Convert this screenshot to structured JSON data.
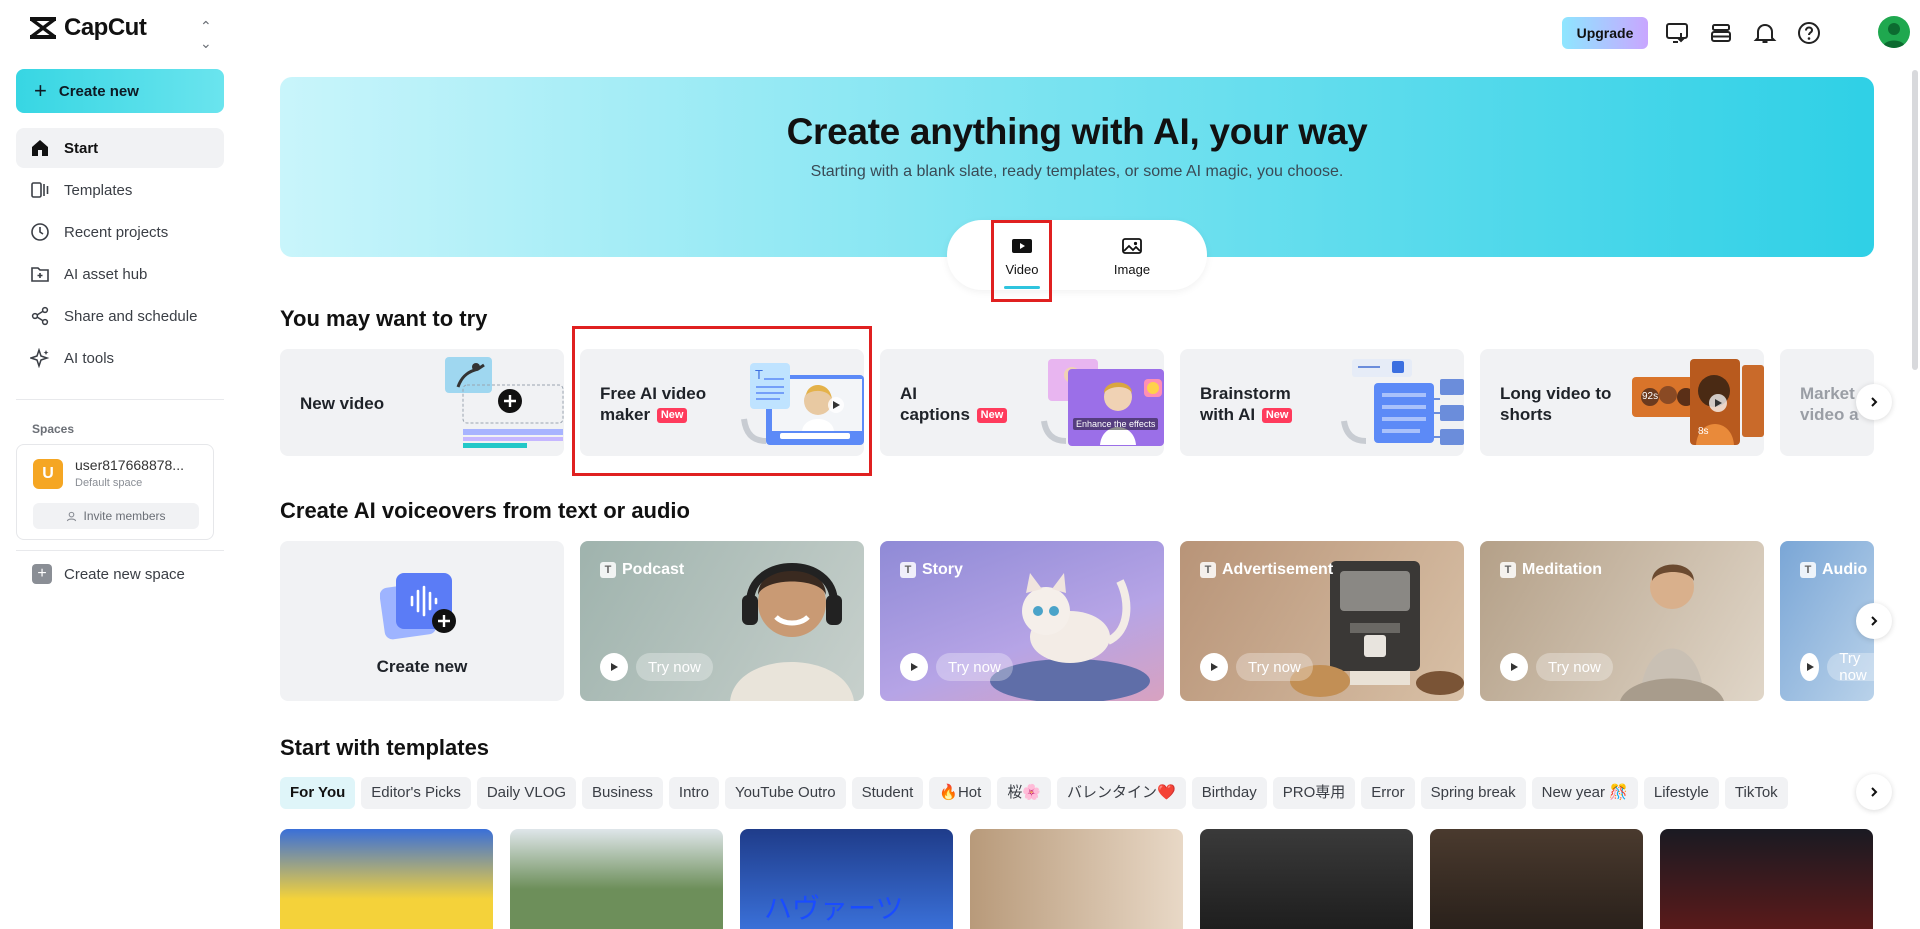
{
  "app": {
    "name": "CapCut"
  },
  "sidebar": {
    "create_new": "Create new",
    "items": [
      {
        "label": "Start"
      },
      {
        "label": "Templates"
      },
      {
        "label": "Recent projects"
      },
      {
        "label": "AI asset hub"
      },
      {
        "label": "Share and schedule"
      },
      {
        "label": "AI tools"
      }
    ],
    "spaces_label": "Spaces",
    "space": {
      "initial": "U",
      "name": "user817668878...",
      "sub": "Default space",
      "invite": "Invite members"
    },
    "create_space": "Create new space"
  },
  "topbar": {
    "upgrade": "Upgrade"
  },
  "hero": {
    "title": "Create anything with AI, your way",
    "subtitle": "Starting with a blank slate, ready templates, or some AI magic, you choose.",
    "modes": [
      {
        "label": "Video"
      },
      {
        "label": "Image"
      }
    ]
  },
  "try_section": {
    "title": "You may want to try",
    "cards": [
      {
        "line1": "New video",
        "line2": "",
        "badge": ""
      },
      {
        "line1": "Free AI video",
        "line2": "maker",
        "badge": "New"
      },
      {
        "line1": "AI",
        "line2": "captions",
        "badge": "New"
      },
      {
        "line1": "Brainstorm",
        "line2": "with AI",
        "badge": "New"
      },
      {
        "line1": "Long video to",
        "line2": "shorts",
        "badge": ""
      },
      {
        "line1": "Market",
        "line2": "video a",
        "badge": ""
      }
    ],
    "card_overlay": {
      "enhance": "Enhance the effects",
      "dur1": "92s",
      "dur2": "8s"
    }
  },
  "voice_section": {
    "title": "Create AI voiceovers from text or audio",
    "create_new": "Create new",
    "try_label": "Try now",
    "cards": [
      {
        "label": "Podcast"
      },
      {
        "label": "Story"
      },
      {
        "label": "Advertisement"
      },
      {
        "label": "Meditation"
      },
      {
        "label": "Audio"
      }
    ]
  },
  "templates_section": {
    "title": "Start with templates",
    "chips": [
      "For You",
      "Editor's Picks",
      "Daily VLOG",
      "Business",
      "Intro",
      "YouTube Outro",
      "Student",
      "🔥Hot",
      "桜🌸",
      "バレンタイン❤️",
      "Birthday",
      "PRO専用",
      "Error",
      "Spring break",
      "New year 🎊",
      "Lifestyle",
      "TikTok"
    ],
    "thumb_text": "ハヴァーツ"
  },
  "colors": {
    "accent": "#2fc4de",
    "highlight": "#e02020",
    "badge": "#ff3b5c"
  }
}
